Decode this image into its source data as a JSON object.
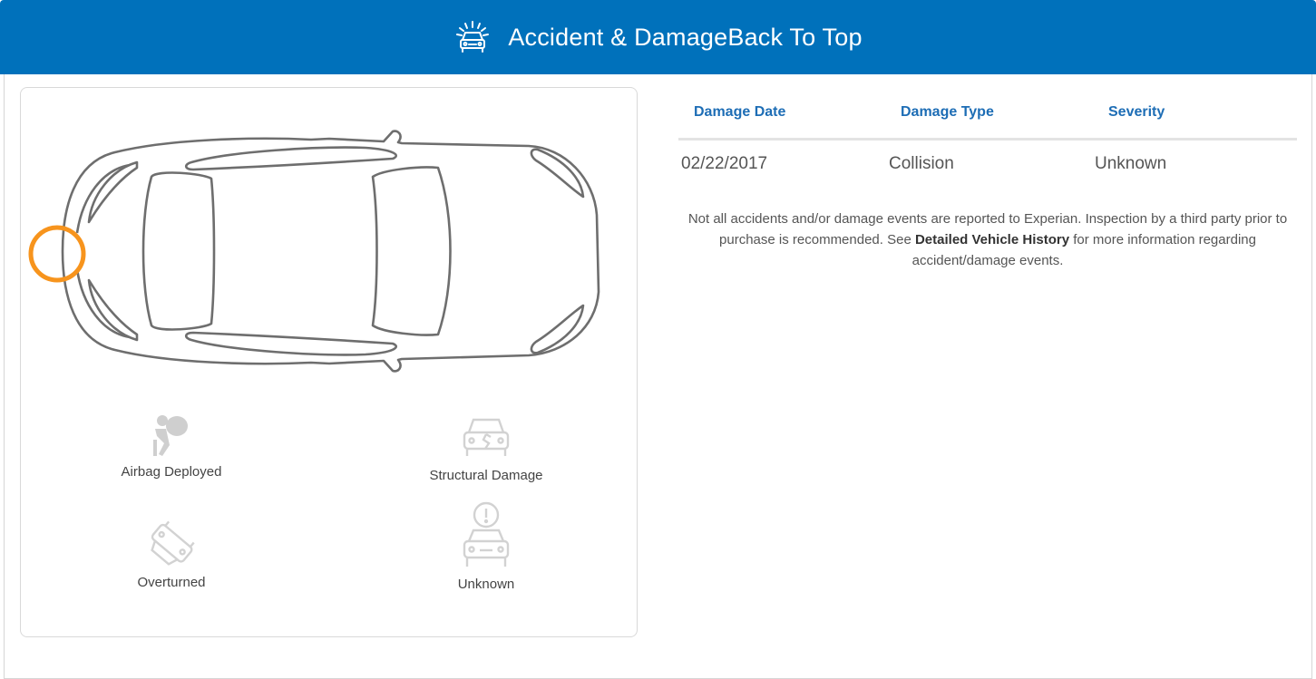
{
  "header": {
    "title": "Accident & Damage",
    "back_link": "Back To Top",
    "icon": "car-crash-icon"
  },
  "legend": {
    "airbag": "Airbag Deployed",
    "structural": "Structural Damage",
    "overturned": "Overturned",
    "unknown": "Unknown"
  },
  "damage_location": "front",
  "table": {
    "headers": [
      "Damage Date",
      "Damage Type",
      "Severity"
    ],
    "rows": [
      [
        "02/22/2017",
        "Collision",
        "Unknown"
      ]
    ]
  },
  "note": {
    "part1": "Not all accidents and/or damage events are reported to Experian. Inspection by a third party prior to purchase is recommended. See ",
    "link": "Detailed Vehicle History",
    "part2": " for more information regarding accident/damage events."
  },
  "colors": {
    "header_bg": "#0071bb",
    "accent": "#1d6db5",
    "damage_marker": "#f7941d"
  }
}
